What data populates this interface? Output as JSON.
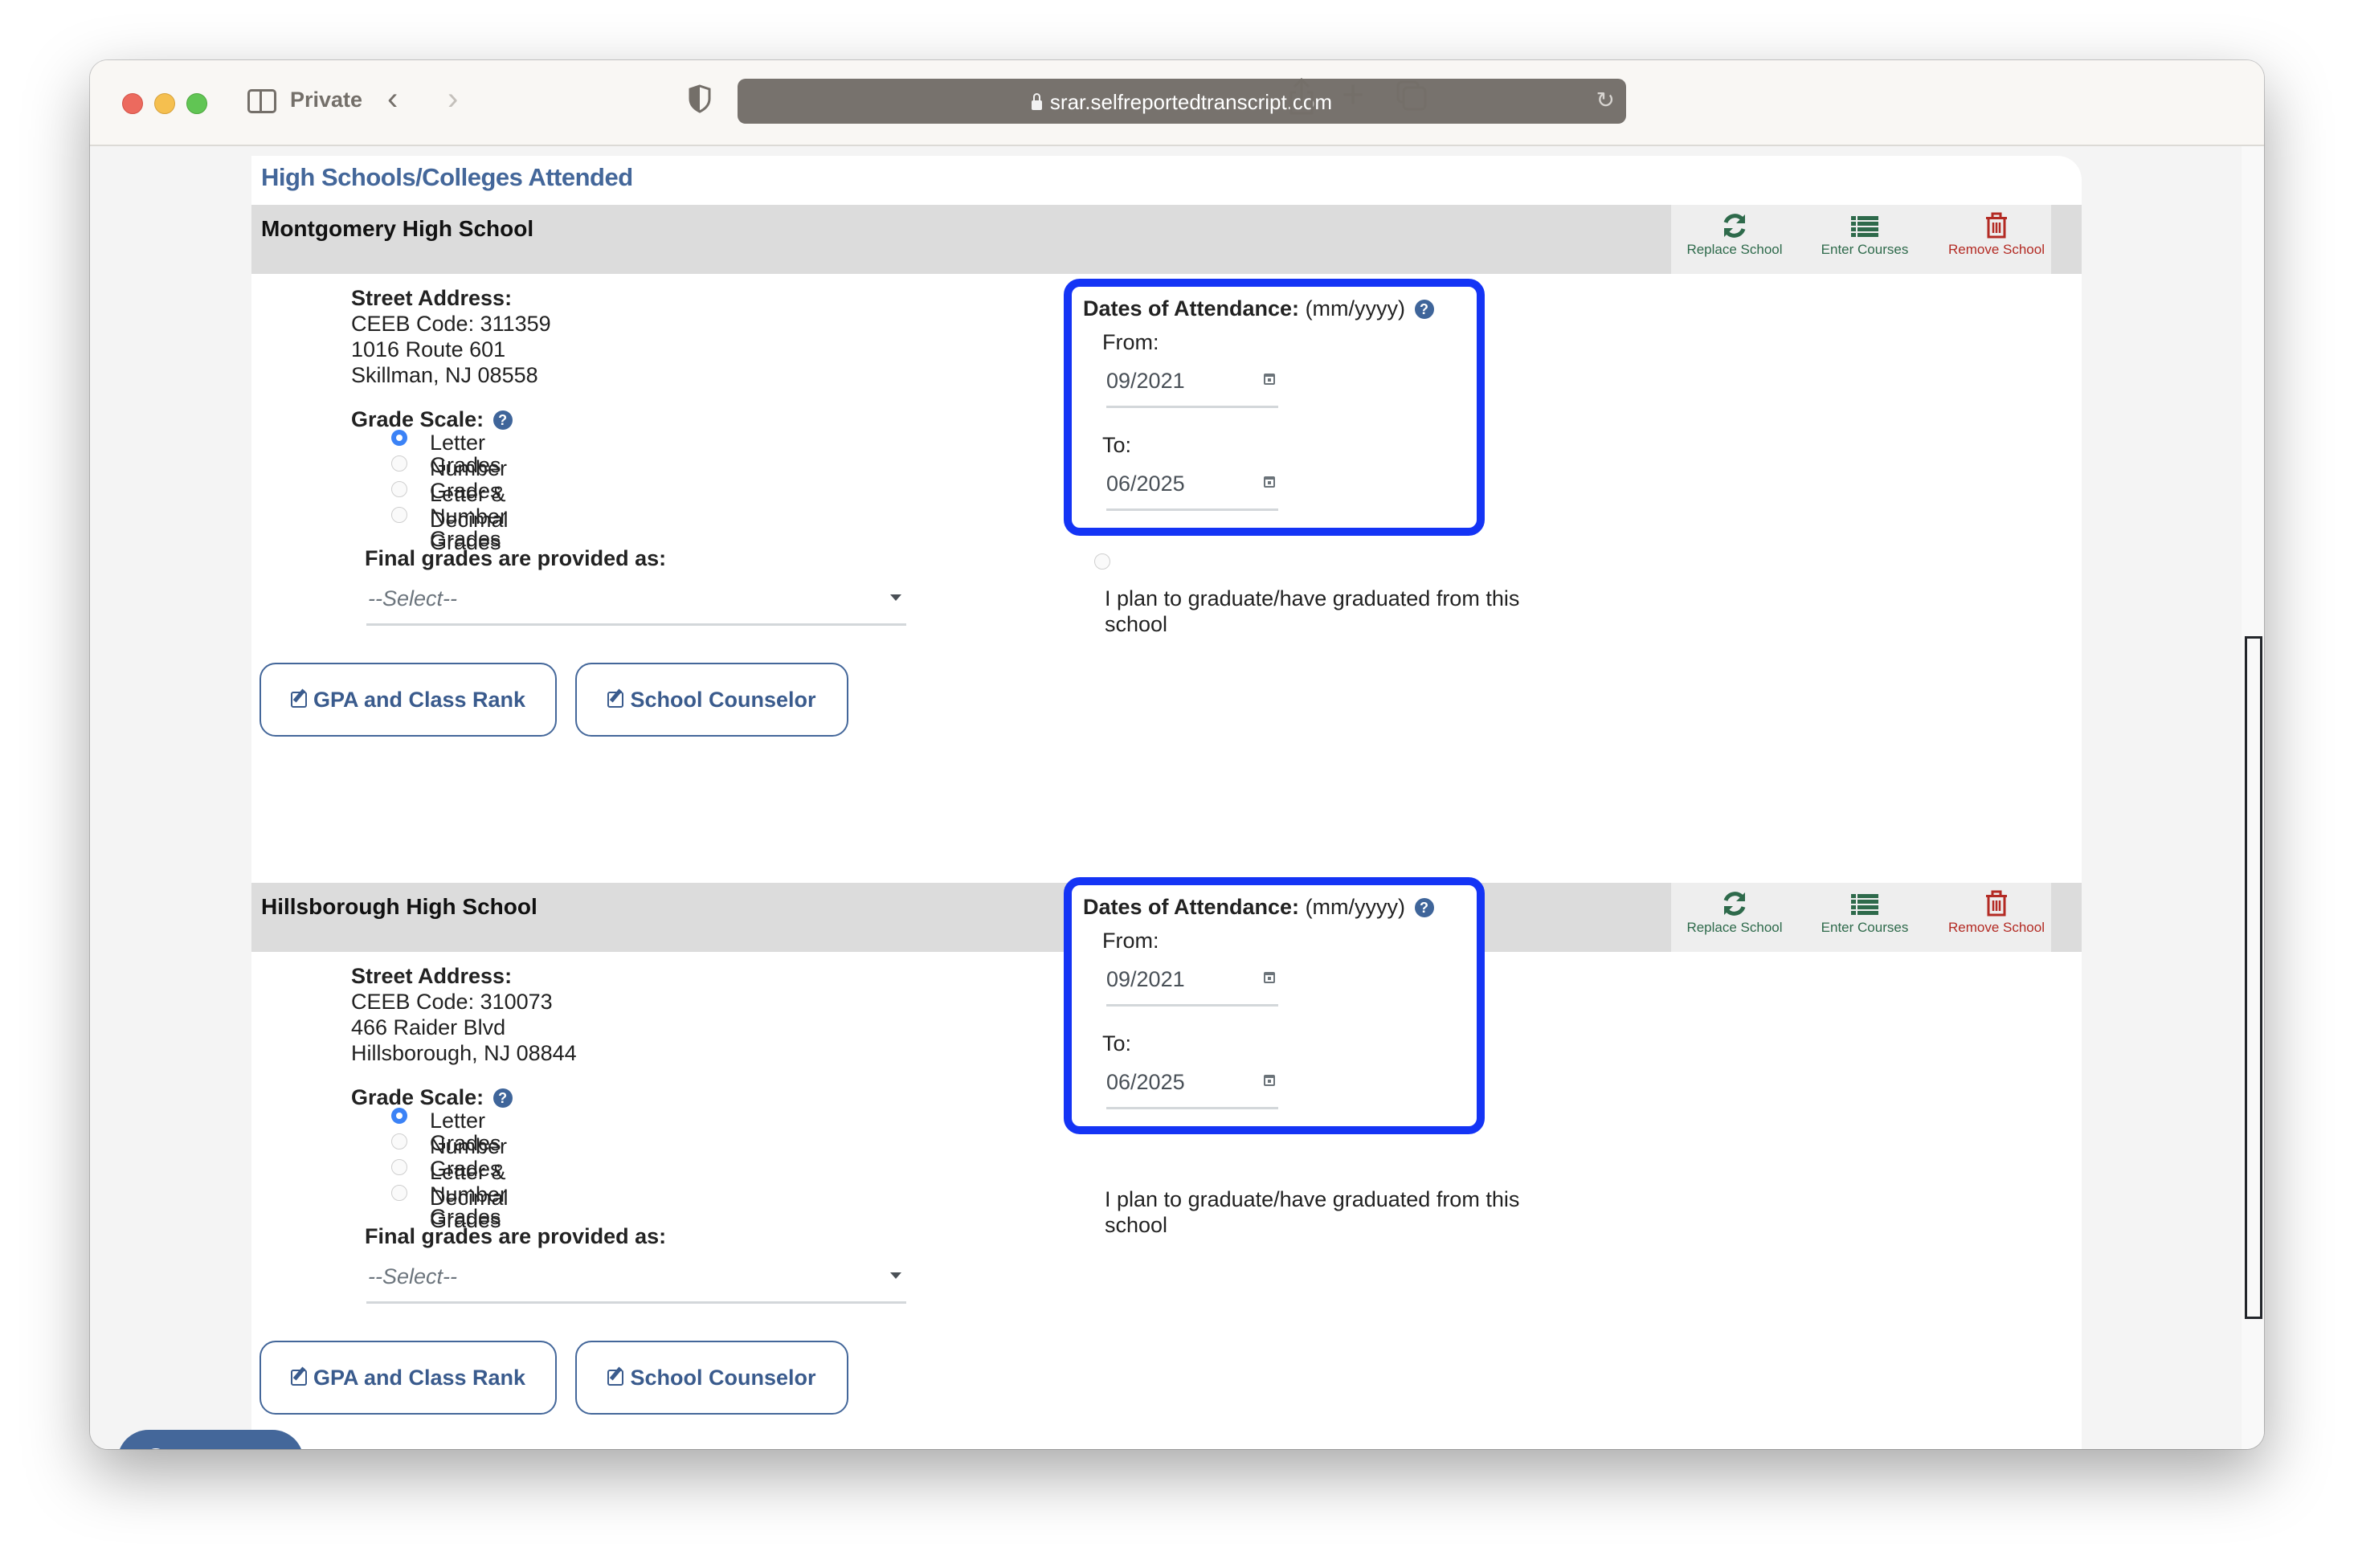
{
  "browser": {
    "private_label": "Private",
    "url": "srar.selfreportedtranscript.com",
    "icons": [
      "sidebar-icon",
      "chevron-left-icon",
      "chevron-right-icon",
      "shield-icon",
      "lock-icon",
      "reload-icon",
      "share-icon",
      "plus-icon",
      "tabs-icon"
    ]
  },
  "page": {
    "heading": "High Schools/Colleges Attended",
    "colors": {
      "heading": "#44679a",
      "action_green": "#2e6a4b",
      "action_red": "#b32a23",
      "highlight_border": "#1434f5",
      "radio_checked": "#3b82f6"
    }
  },
  "actions": {
    "replace": "Replace School",
    "courses": "Enter Courses",
    "remove": "Remove School"
  },
  "labels": {
    "street_address": "Street Address:",
    "grade_scale": "Grade Scale:",
    "help": "?",
    "final_grades": "Final grades are provided as:",
    "dates_title": "Dates of Attendance:",
    "dates_format": "(mm/yyyy)",
    "from": "From:",
    "to": "To:",
    "graduate": "I plan to graduate/have graduated from this school",
    "gpa_button": "GPA and Class Rank",
    "counselor_button": "School Counselor"
  },
  "schools": [
    {
      "name": "Montgomery High School",
      "ceeb": "CEEB Code: 311359",
      "street": "1016 Route 601",
      "city": "Skillman, NJ 08558",
      "grade_scale_options": [
        "Letter Grades",
        "Number Grades",
        "Letter & Number Grades",
        "Decimal Grades"
      ],
      "grade_scale_selected": "Letter Grades",
      "final_grades_select": "--Select--",
      "date_from": "09/2021",
      "date_to": "06/2025",
      "graduate_checked": false
    },
    {
      "name": "Hillsborough High School",
      "ceeb": "CEEB Code: 310073",
      "street": "466 Raider Blvd",
      "city": "Hillsborough, NJ 08844",
      "grade_scale_options": [
        "Letter Grades",
        "Number Grades",
        "Letter & Number Grades",
        "Decimal Grades"
      ],
      "grade_scale_selected": "Letter Grades",
      "final_grades_select": "--Select--",
      "date_from": "09/2021",
      "date_to": "06/2025",
      "graduate_checked": true
    }
  ],
  "support": {
    "label": "Support",
    "icon": "?"
  }
}
